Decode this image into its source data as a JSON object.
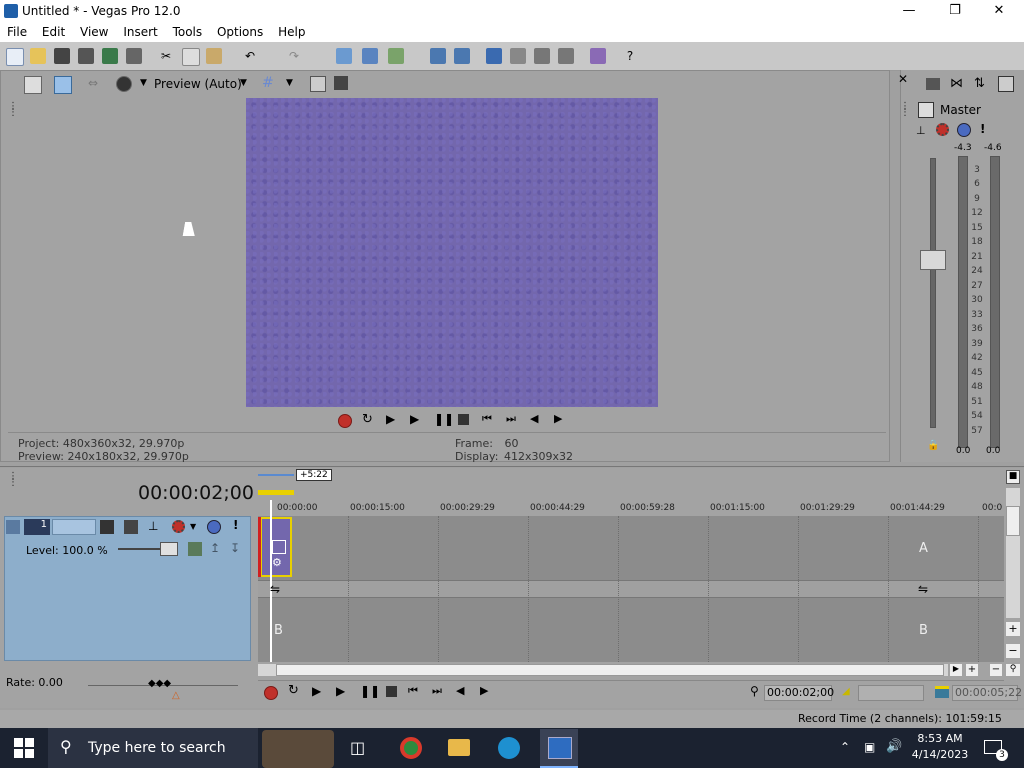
{
  "window": {
    "title": "Untitled * - Vegas Pro 12.0"
  },
  "menu": {
    "items": [
      "File",
      "Edit",
      "View",
      "Insert",
      "Tools",
      "Options",
      "Help"
    ]
  },
  "preview": {
    "mode_label": "Preview (Auto)",
    "project_label": "Project:",
    "project_value": "480x360x32, 29.970p",
    "preview_label": "Preview:",
    "preview_value": "240x180x32, 29.970p",
    "frame_label": "Frame:",
    "frame_value": "60",
    "display_label": "Display:",
    "display_value": "412x309x32"
  },
  "master": {
    "title": "Master",
    "peak_left": "-4.3",
    "peak_right": "-4.6",
    "scale": [
      "3",
      "6",
      "9",
      "12",
      "15",
      "18",
      "21",
      "24",
      "27",
      "30",
      "33",
      "36",
      "39",
      "42",
      "45",
      "48",
      "51",
      "54",
      "57"
    ],
    "bottom_left": "0.0",
    "bottom_right": "0.0"
  },
  "timeline": {
    "timecode": "00:00:02;00",
    "marker_badge": "+5:22",
    "ruler": [
      "00:00:00",
      "00:00:15:00",
      "00:00:29:29",
      "00:00:44:29",
      "00:00:59:28",
      "00:01:15:00",
      "00:01:29:29",
      "00:01:44:29",
      "00:0"
    ],
    "track_number": "1",
    "level_label": "Level: 100.0 %",
    "lane_a": "A",
    "lane_b": "B",
    "rate_label": "Rate: 0.00",
    "cursor_time": "00:00:02;00",
    "end_time": "00:00:05;22"
  },
  "status": {
    "record_time": "Record Time (2 channels): 101:59:15"
  },
  "taskbar": {
    "search_placeholder": "Type here to search",
    "time": "8:53 AM",
    "date": "4/14/2023",
    "notification_count": "3"
  },
  "colors": {
    "video_fill": "#7367ad",
    "track_header": "#8daecb",
    "taskbar": "#1b2230"
  }
}
